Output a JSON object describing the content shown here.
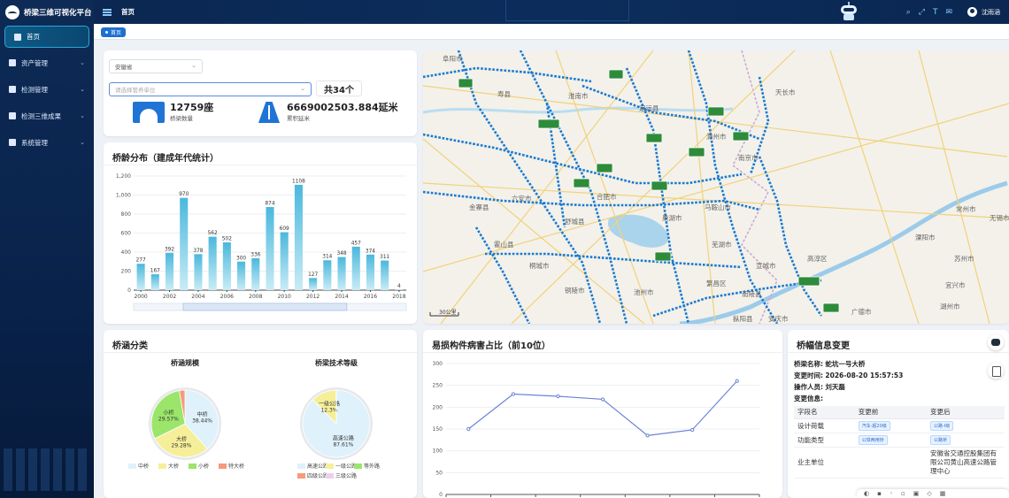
{
  "app": {
    "title": "桥梁三维可视化平台"
  },
  "sidebar": {
    "items": [
      {
        "label": "首页",
        "icon": "dashboard-icon",
        "active": true,
        "chevron": ""
      },
      {
        "label": "资产管理",
        "icon": "asset-icon",
        "active": false,
        "chevron": "⌄"
      },
      {
        "label": "检测管理",
        "icon": "inspection-icon",
        "active": false,
        "chevron": "⌄"
      },
      {
        "label": "检测三维成果",
        "icon": "3d-result-icon",
        "active": false,
        "chevron": "⌄"
      },
      {
        "label": "系统管理",
        "icon": "settings-icon",
        "active": false,
        "chevron": "⌄"
      }
    ]
  },
  "topbar": {
    "breadcrumb": "首页",
    "user": "沈雨涵"
  },
  "tabs": [
    {
      "label": "首页"
    }
  ],
  "filter": {
    "province": "安徽省",
    "unit_placeholder": "请选择管养单位",
    "count": "共34个",
    "bridge_count": "12759座",
    "bridge_count_label": "桥梁数量",
    "length": "6669002503.884延米",
    "length_label": "累积延米"
  },
  "age_chart": {
    "title": "桥龄分布（建成年代统计）"
  },
  "culvert": {
    "title": "桥涵分类",
    "scale_title": "桥涵规模",
    "grade_title": "桥梁技术等级"
  },
  "damage": {
    "title": "易损构件病害占比（前10位）"
  },
  "info": {
    "title": "桥幅信息变更",
    "bridge_name_label": "桥梁名称:",
    "bridge_name": "蛇坑一号大桥",
    "change_time_label": "变更时间:",
    "change_time": "2026-08-20 15:57:53",
    "operator_label": "操作人员:",
    "operator": "刘天磊",
    "change_info_label": "变更信息:",
    "columns": [
      "字段名",
      "变更前",
      "变更后"
    ],
    "rows": [
      {
        "field": "设计荷载",
        "before": "汽车-超20级",
        "after": "公路-Ⅰ级"
      },
      {
        "field": "功能类型",
        "before": "公铁两用桥",
        "after": "公路桥"
      },
      {
        "field": "业主单位",
        "before": "",
        "after": "安徽省交通控股集团有限公司黄山高速公路管理中心"
      }
    ]
  },
  "map": {
    "scale": "30公里",
    "places": [
      "阜阳市",
      "淮南市",
      "定远县",
      "天长市",
      "滁州市",
      "寿县",
      "南京市",
      "六安市",
      "合肥市",
      "马鞍山市",
      "金寨县",
      "霍山县",
      "巢湖市",
      "芜湖市",
      "宣城市",
      "铜陵市",
      "池州市",
      "溧阳市",
      "常州市",
      "无锡市",
      "苏州市",
      "高淳区",
      "广德市",
      "湖州市",
      "宜兴市",
      "舒城县",
      "枞阳县",
      "安庆市",
      "繁昌区",
      "南陵县",
      "桐城市"
    ]
  },
  "colors": {
    "accent": "#1f74d6",
    "sidebar": "#0d2b56",
    "bar": "#6fcde6"
  },
  "chart_data": [
    {
      "type": "bar",
      "title": "",
      "categories": [
        "2000",
        "2001",
        "2002",
        "2003",
        "2004",
        "2005",
        "2006",
        "2007",
        "2008",
        "2009",
        "2010",
        "2011",
        "2012",
        "2013",
        "2014",
        "2015",
        "2016",
        "2017",
        "2018"
      ],
      "x_tick_labels": [
        "2000",
        "2002",
        "2004",
        "2006",
        "2008",
        "2010",
        "2012",
        "2014",
        "2016",
        "2018"
      ],
      "values": [
        277,
        167,
        392,
        970,
        378,
        562,
        502,
        300,
        336,
        874,
        609,
        1108,
        127,
        314,
        348,
        457,
        374,
        311,
        4
      ],
      "ylim": [
        0,
        1200
      ],
      "y_ticks": [
        "0",
        "200",
        "400",
        "600",
        "800",
        "1,000",
        "1,200"
      ],
      "grid": true
    },
    {
      "type": "pie",
      "title": "桥涵规模",
      "slices": [
        {
          "label": "中桥",
          "value": 38.44,
          "color": "#dff1fb"
        },
        {
          "label": "大桥",
          "value": 29.28,
          "color": "#f6ef9a"
        },
        {
          "label": "小桥",
          "value": 29.57,
          "color": "#9be56a"
        },
        {
          "label": "特大桥",
          "value": 2.71,
          "color": "#f59a7a"
        }
      ],
      "legend": "bottom"
    },
    {
      "type": "pie",
      "title": "桥梁技术等级",
      "slices": [
        {
          "label": "高速公路",
          "value": 87.61,
          "color": "#dff1fb"
        },
        {
          "label": "一级公路",
          "value": 12.3,
          "color": "#f6ef9a"
        },
        {
          "label": "等外路",
          "value": 0.03,
          "color": "#9be56a"
        },
        {
          "label": "四级公路",
          "value": 0.03,
          "color": "#f59a7a"
        },
        {
          "label": "三级公路",
          "value": 0.03,
          "color": "#ead0f0"
        }
      ],
      "legend": "bottom"
    },
    {
      "type": "line",
      "title": "",
      "values": [
        150,
        230,
        225,
        218,
        135,
        148,
        260
      ],
      "ylim": [
        0,
        300
      ],
      "y_ticks": [
        "0",
        "50",
        "100",
        "150",
        "200",
        "250",
        "300"
      ],
      "grid": true
    }
  ]
}
